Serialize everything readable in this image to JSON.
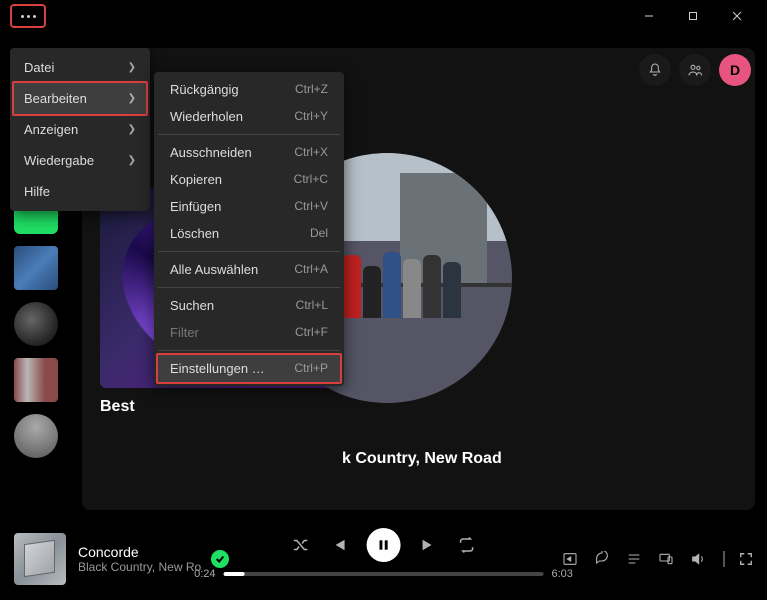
{
  "window": {
    "minimize": "–",
    "maximize": "□",
    "close": "✕"
  },
  "user": {
    "initial": "D"
  },
  "menu": {
    "items": [
      {
        "label": "Datei"
      },
      {
        "label": "Bearbeiten",
        "active": true
      },
      {
        "label": "Anzeigen"
      },
      {
        "label": "Wiedergabe"
      },
      {
        "label": "Hilfe"
      }
    ]
  },
  "submenu": {
    "groups": [
      [
        {
          "label": "Rückgängig",
          "shortcut": "Ctrl+Z"
        },
        {
          "label": "Wiederholen",
          "shortcut": "Ctrl+Y"
        }
      ],
      [
        {
          "label": "Ausschneiden",
          "shortcut": "Ctrl+X"
        },
        {
          "label": "Kopieren",
          "shortcut": "Ctrl+C"
        },
        {
          "label": "Einfügen",
          "shortcut": "Ctrl+V"
        },
        {
          "label": "Löschen",
          "shortcut": "Del"
        }
      ],
      [
        {
          "label": "Alle Auswählen",
          "shortcut": "Ctrl+A"
        }
      ],
      [
        {
          "label": "Suchen",
          "shortcut": "Ctrl+L"
        },
        {
          "label": "Filter",
          "shortcut": "Ctrl+F",
          "disabled": true
        }
      ],
      [
        {
          "label": "Einstellungen …",
          "shortcut": "Ctrl+P",
          "hot": true
        }
      ]
    ]
  },
  "content": {
    "card_title": "Best",
    "artist_name": "k Country, New Road"
  },
  "player": {
    "title": "Concorde",
    "artist": "Black Country, New Ro",
    "elapsed": "0:24",
    "total": "6:03"
  }
}
